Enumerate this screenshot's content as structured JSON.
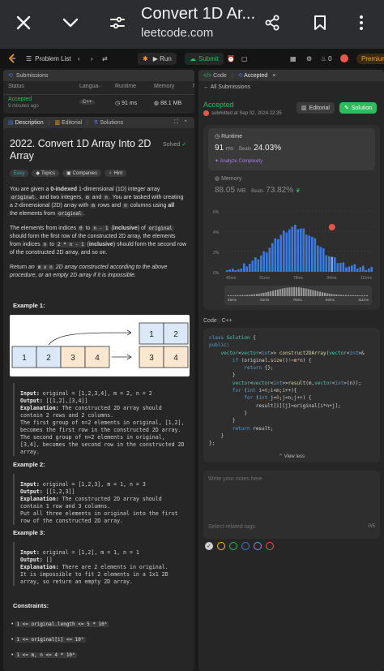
{
  "browser": {
    "title": "Convert 1D Ar...",
    "url": "leetcode.com"
  },
  "toolbar": {
    "problem_list": "Problem List",
    "run": "Run",
    "submit": "Submit",
    "streak": "0",
    "premium": "Premium"
  },
  "submissions_panel": {
    "title": "Submissions",
    "columns": [
      "Status",
      "Langua··",
      "Runtime",
      "Memory",
      "N"
    ],
    "row": {
      "status": "Accepted",
      "time": "9 minutes ago",
      "lang": "C++",
      "runtime": "91 ms",
      "memory": "88.1 MB"
    }
  },
  "desc_tabs": [
    "Description",
    "Editorial",
    "Solutions"
  ],
  "problem": {
    "title_line1": "2022. Convert 1D Array Into 2D",
    "title_line2": "Array",
    "solved": "Solved",
    "tags": [
      "Easy",
      "Topics",
      "Companies",
      "Hint"
    ],
    "p1": [
      "You are given a ",
      "0-indexed",
      " 1-dimensional (1D) integer array"
    ],
    "p1b": [
      "original",
      ", and two integers, ",
      "m",
      " and ",
      "n",
      ". You are tasked with creating"
    ],
    "p1c": [
      "a 2-dimensional (2D) array with ",
      "m",
      " rows and ",
      "n",
      " columns using ",
      "all"
    ],
    "p1d": [
      "the elements from ",
      "original",
      "."
    ],
    "p2": [
      "The elements from indices ",
      "0",
      " to ",
      "n - 1",
      " (",
      "inclusive",
      ") of ",
      "original"
    ],
    "p2b": "should form the first row of the constructed 2D array, the elements",
    "p2c": [
      "from indices ",
      "n",
      " to ",
      "2 * n - 1",
      " (",
      "inclusive",
      ") should form the second row"
    ],
    "p2d": "of the constructed 2D array, and so on.",
    "p3a": [
      "Return ",
      "an ",
      "m x n",
      " 2D array constructed according to the above"
    ],
    "p3b": "procedure, or an empty 2D array if it is impossible.",
    "example1_title": "Example 1:",
    "diagram_left": [
      "1",
      "2",
      "3",
      "4"
    ],
    "diagram_right": [
      "1",
      "2",
      "3",
      "4"
    ],
    "ex1": {
      "input_label": "Input:",
      "input": " original = [1,2,3,4], m = 2, n = 2",
      "output_label": "Output:",
      "output": " [[1,2],[3,4]]",
      "expl_label": "Explanation:",
      "expl1": " The constructed 2D array should",
      "lines": [
        "contain 2 rows and 2 columns.",
        "The first group of n=2 elements in original, [1,2],",
        "becomes the first row in the constructed 2D array.",
        "The second group of n=2 elements in original,",
        "[3,4], becomes the second row in the constructed 2D",
        "array."
      ]
    },
    "example2_title": "Example 2:",
    "ex2": {
      "input_label": "Input:",
      "input": " original = [1,2,3], m = 1, n = 3",
      "output_label": "Output:",
      "output": " [[1,2,3]]",
      "expl_label": "Explanation:",
      "expl1": " The constructed 2D array should",
      "lines": [
        "contain 1 row and 3 columns.",
        "Put all three elements in original into the first",
        "row of the constructed 2D array."
      ]
    },
    "example3_title": "Example 3:",
    "ex3": {
      "input_label": "Input:",
      "input": " original = [1,2], m = 1, n = 1",
      "output_label": "Output:",
      "output": " []",
      "expl_label": "Explanation:",
      "expl1": " There are 2 elements in original.",
      "lines": [
        "It is impossible to fit 2 elements in a 1x1 2D",
        "array, so return an empty 2D array."
      ]
    },
    "constraints_title": "Constraints:",
    "constraints": [
      "1 <= original.length <= 5 * 10⁴",
      "1 <= original[i] <= 10⁵",
      "1 <= m, n <= 4 * 10⁴"
    ]
  },
  "right_tabs": {
    "code": "Code",
    "accepted": "Accepted"
  },
  "result": {
    "back": "All Submissions",
    "status": "Accepted",
    "submitted": "submitted at Sep 02, 2024 22:35",
    "editorial": "Editorial",
    "solution": "Solution",
    "runtime_label": "Runtime",
    "runtime_value": "91",
    "runtime_unit": "ms",
    "beats_label": "Beats",
    "runtime_beats": "24.03%",
    "analyze": "Analyze Complexity",
    "memory_label": "Memory",
    "memory_value": "88.05",
    "memory_unit": "MB",
    "memory_beats": "73.82%",
    "y_ticks": [
      "6%",
      "4%",
      "2%",
      "0%"
    ],
    "x_ticks": [
      "45ms",
      "61ms",
      "78ms",
      "94ms",
      "111ms"
    ],
    "mini_ticks": [
      "45ms",
      "61ms",
      "78ms",
      "94ms",
      "111ms"
    ]
  },
  "code_section": {
    "label": "Code",
    "lang": "C++",
    "view_less": "View less"
  },
  "notes": {
    "placeholder": "Write your notes here",
    "tags_placeholder": "Select related tags",
    "count": "0/5"
  },
  "colors": {
    "accent_green": "#2cbb5d",
    "leetcode_orange": "#ffa116",
    "bar_blue": "#3d7ae0",
    "bar_highlight": "#7ea7ef"
  }
}
